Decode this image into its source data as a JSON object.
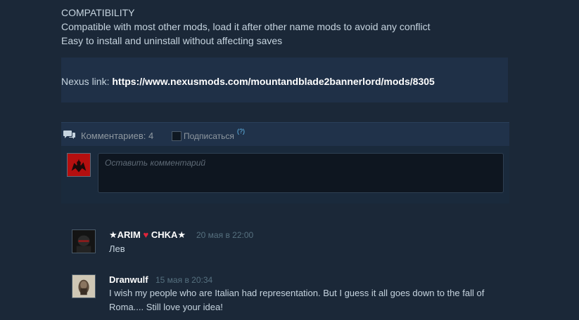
{
  "description": {
    "lines": [
      "COMPATIBILITY",
      "Compatible with most other mods, load it after other name mods to avoid any conflict",
      "Easy to install and uninstall without affecting saves"
    ],
    "nexus_label": "Nexus link:",
    "nexus_url": "https://www.nexusmods.com/mountandblade2bannerlord/mods/8305"
  },
  "comments_header": {
    "count_label": "Комментариев: 4",
    "subscribe_label": "Подписаться",
    "help": "(?)"
  },
  "compose": {
    "placeholder": "Оставить комментарий"
  },
  "comments": [
    {
      "author": "★ARIM ♥ CHKA★",
      "time": "20 мая в 22:00",
      "text": "Лев"
    },
    {
      "author": "Dranwulf",
      "time": "15 мая в 20:34",
      "text": "I wish my people who are Italian had representation. But I guess it all goes down to the fall of Roma.... Still love your idea!"
    }
  ],
  "colors": {
    "page_bg": "#1b2838",
    "panel_bg": "#20324a",
    "link": "#66c0f4",
    "heart": "#e0243a"
  }
}
